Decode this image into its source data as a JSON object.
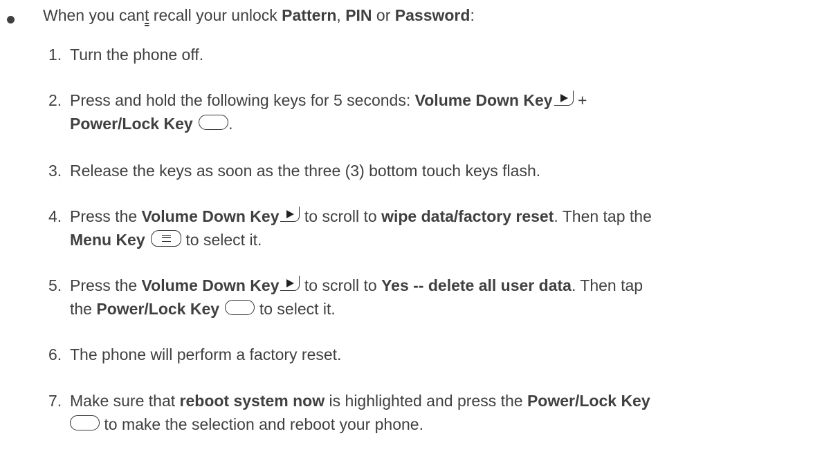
{
  "bullet": {
    "t1": "When you can",
    "t_under": "t",
    "t2": " recall your unlock ",
    "pattern": "Pattern",
    "comma": ", ",
    "pin": "PIN",
    "or": " or ",
    "password": "Password",
    "colon": ":"
  },
  "steps": {
    "s1": {
      "num": "1.",
      "text": "Turn the phone off."
    },
    "s2": {
      "num": "2.",
      "t1": "Press and hold the following keys for 5 seconds: ",
      "vol": "Volume Down Key",
      "plus": " +",
      "power": "Power/Lock Key",
      "end": "."
    },
    "s3": {
      "num": "3.",
      "text": "Release the keys as soon as the three (3) bottom touch keys flash."
    },
    "s4": {
      "num": "4.",
      "t1": "Press the ",
      "vol": "Volume Down Key",
      "t2": " to scroll to ",
      "wipe": "wipe data/factory reset",
      "t3": ". Then tap the",
      "menu": "Menu Key",
      "t4": " to select it."
    },
    "s5": {
      "num": "5.",
      "t1": "Press the ",
      "vol": "Volume Down Key",
      "t2": " to scroll to ",
      "yes": "Yes -- delete all user data",
      "t3": ". Then tap",
      "t4": "the ",
      "power": "Power/Lock Key",
      "t5": " to select it."
    },
    "s6": {
      "num": "6.",
      "text": "The phone will perform a factory reset."
    },
    "s7": {
      "num": "7.",
      "t1": "Make sure that ",
      "reboot": "reboot system now",
      "t2": " is highlighted and press the ",
      "power": "Power/Lock Key",
      "t3": " to make the selection and reboot your phone."
    }
  },
  "icons": {
    "volume_down": "play-triangle-key-icon",
    "power_lock": "pill-key-icon",
    "menu": "menu-lines-key-icon"
  }
}
